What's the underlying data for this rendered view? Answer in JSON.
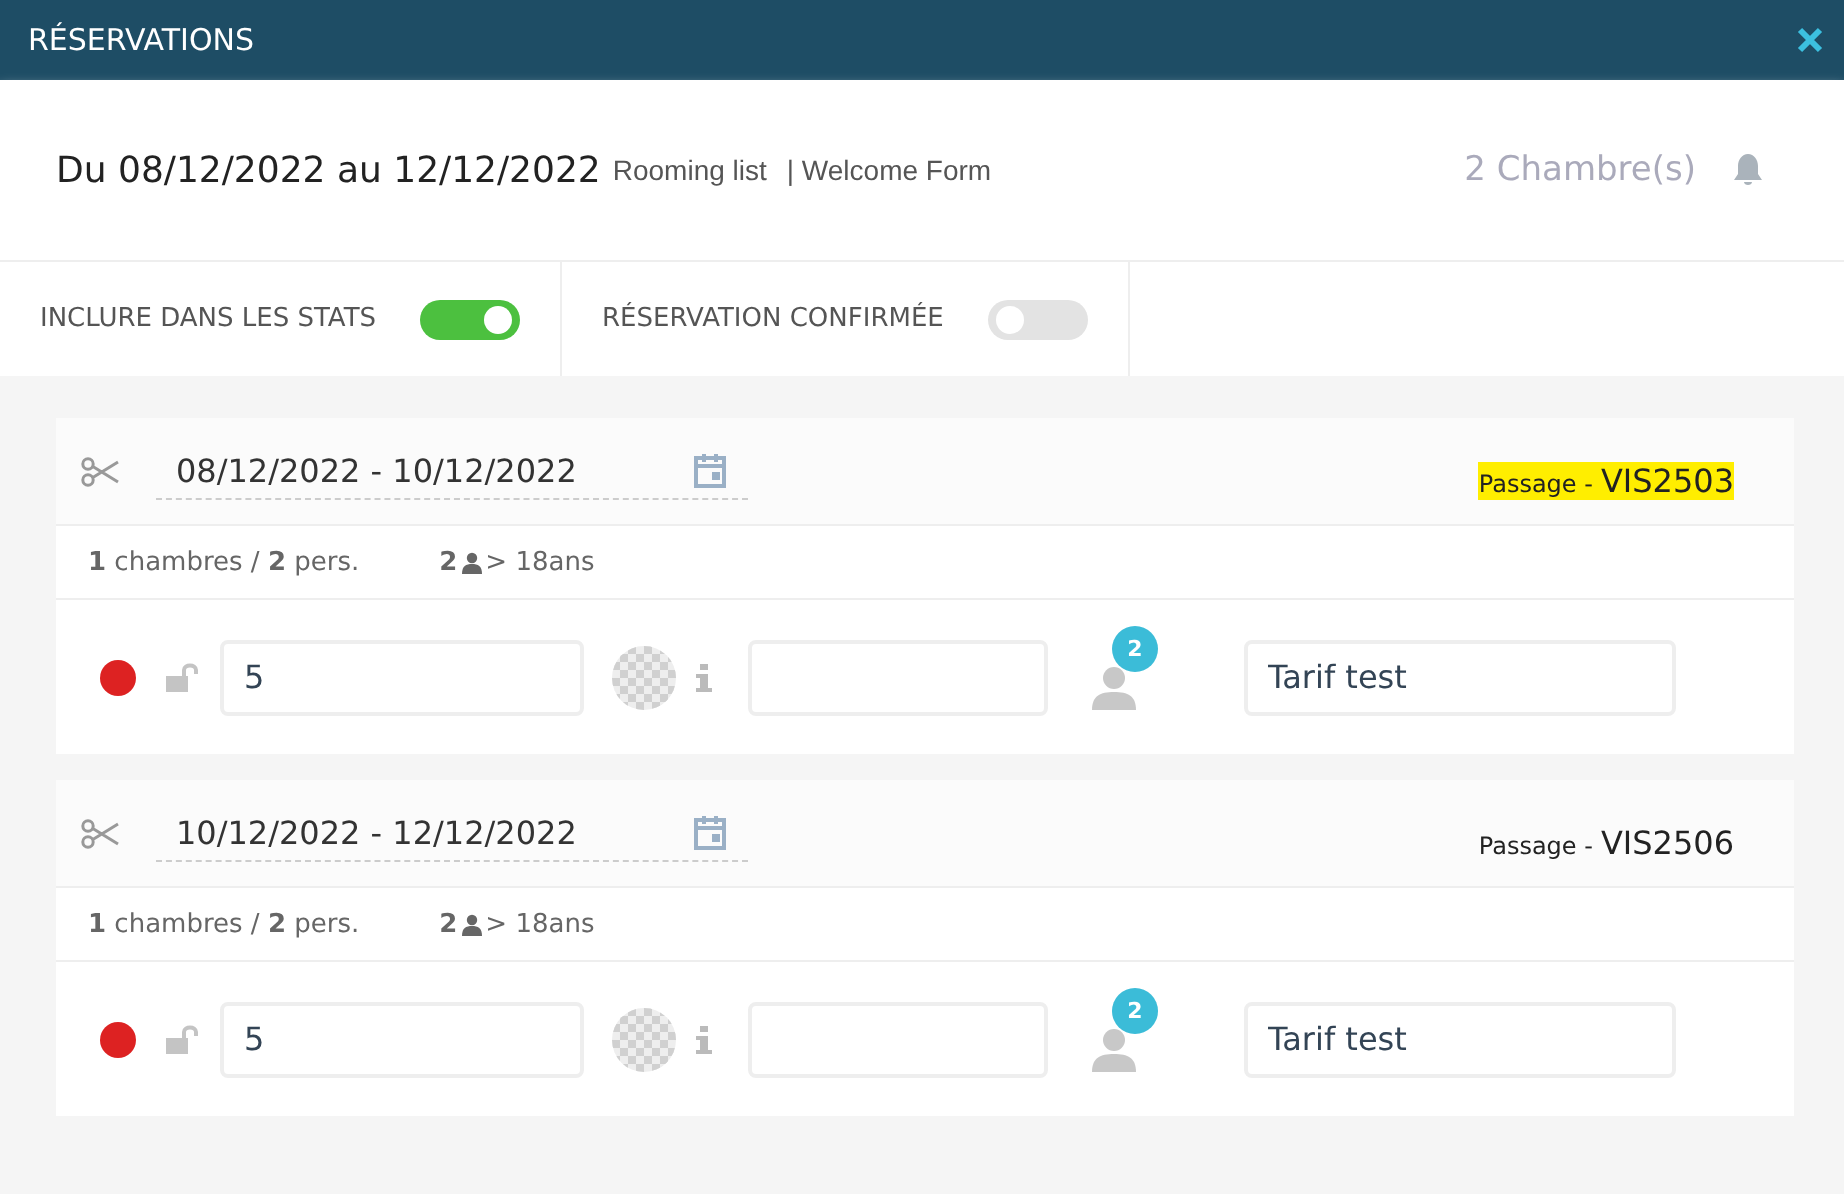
{
  "window": {
    "title": "RÉSERVATIONS"
  },
  "summary": {
    "period": "Du 08/12/2022 au 12/12/2022",
    "links": [
      "Rooming list",
      "| Welcome Form"
    ],
    "rooms": "2 Chambre(s)"
  },
  "toggles": [
    {
      "label": "INCLURE DANS LES STATS",
      "on": true
    },
    {
      "label": "RÉSERVATION CONFIRMÉE",
      "on": false
    }
  ],
  "reservations": [
    {
      "dates": "08/12/2022 - 10/12/2022",
      "passage_label": "Passage -",
      "passage_code": "VIS2503",
      "highlighted": true,
      "stats": "**1** chambres / **2** pers.",
      "adults": "2",
      "adults_label": "> 18ans",
      "room": "5",
      "guests_badge": "2",
      "rate": "Tarif test"
    },
    {
      "dates": "10/12/2022 - 12/12/2022",
      "passage_label": "Passage -",
      "passage_code": "VIS2506",
      "highlighted": false,
      "stats": "**1** chambres / **2** pers.",
      "adults": "2",
      "adults_label": "> 18ans",
      "room": "5",
      "guests_badge": "2",
      "rate": "Tarif test"
    }
  ]
}
